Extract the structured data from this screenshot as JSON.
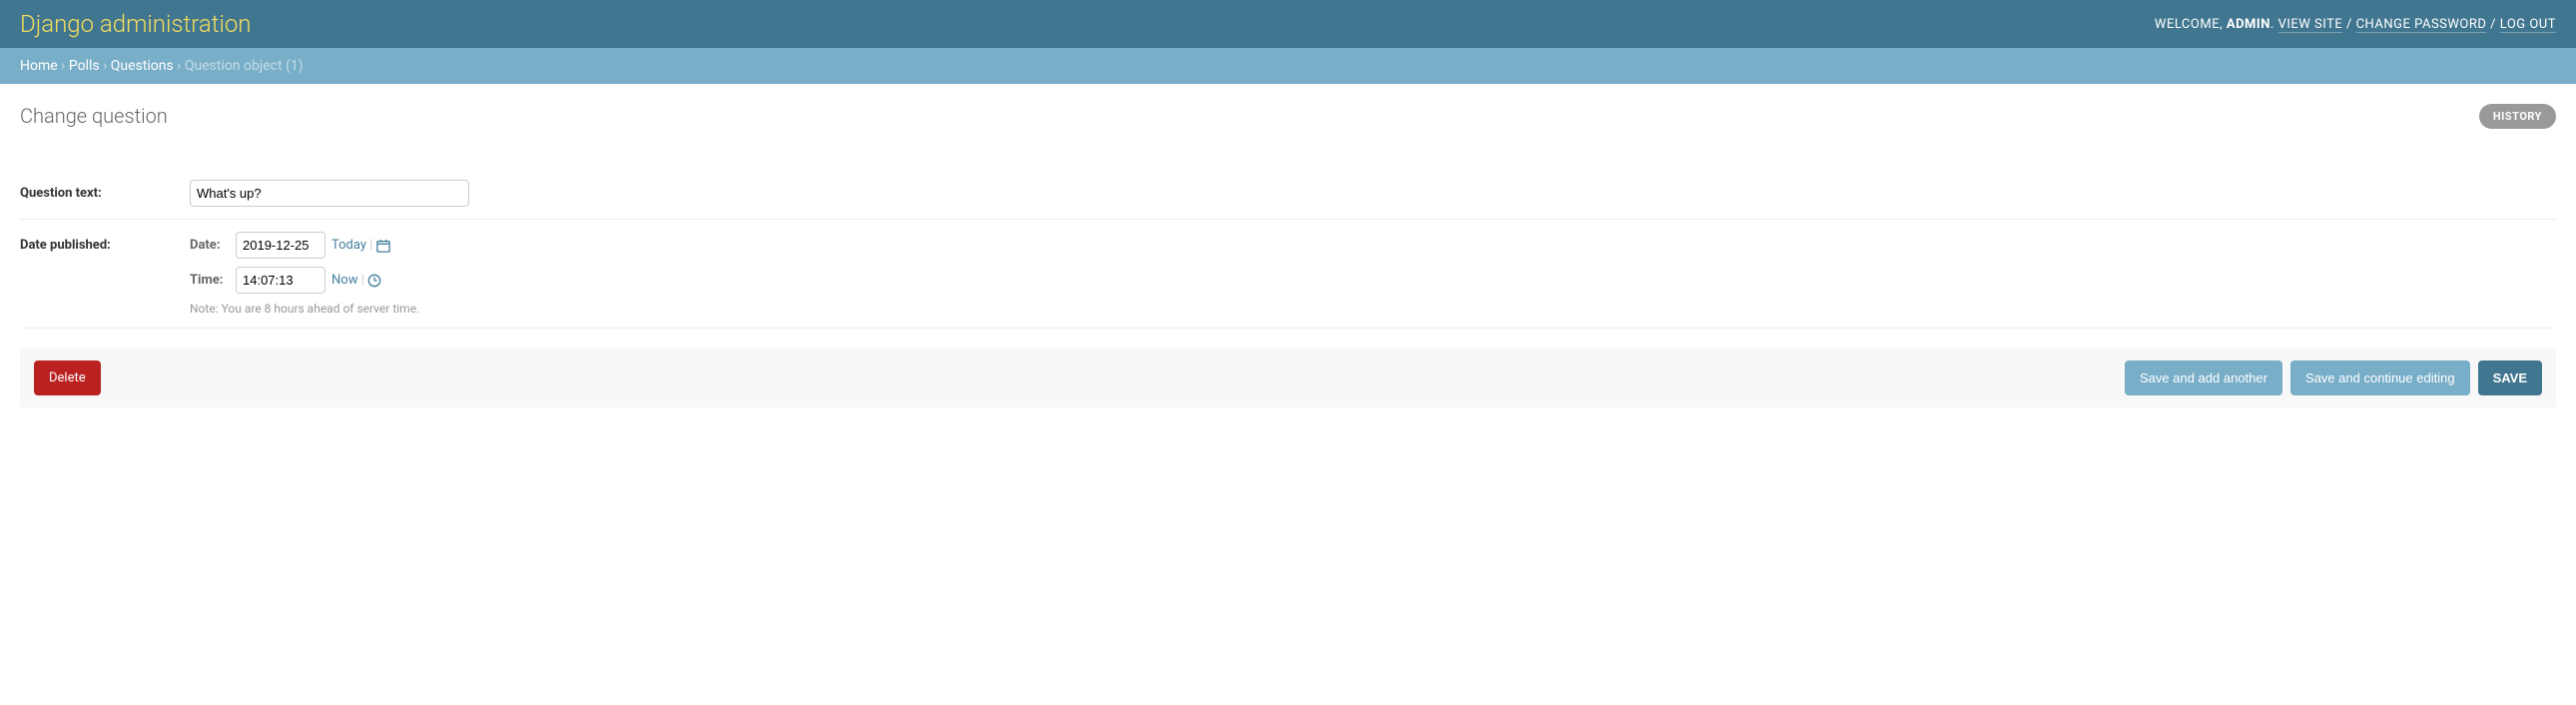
{
  "header": {
    "branding": "Django administration",
    "welcome_prefix": "WELCOME, ",
    "username": "ADMIN",
    "view_site": "VIEW SITE",
    "change_password": "CHANGE PASSWORD",
    "logout": "LOG OUT"
  },
  "breadcrumbs": {
    "home": "Home",
    "app": "Polls",
    "model": "Questions",
    "object": "Question object (1)"
  },
  "content": {
    "title": "Change question",
    "history_label": "HISTORY"
  },
  "form": {
    "question_text": {
      "label": "Question text:",
      "value": "What's up?"
    },
    "pub_date": {
      "label": "Date published:",
      "date_label": "Date:",
      "date_value": "2019-12-25",
      "today_label": "Today",
      "time_label": "Time:",
      "time_value": "14:07:13",
      "now_label": "Now",
      "tz_warning": "Note: You are 8 hours ahead of server time."
    }
  },
  "submit": {
    "delete": "Delete",
    "save_add_another": "Save and add another",
    "save_continue": "Save and continue editing",
    "save": "SAVE"
  }
}
